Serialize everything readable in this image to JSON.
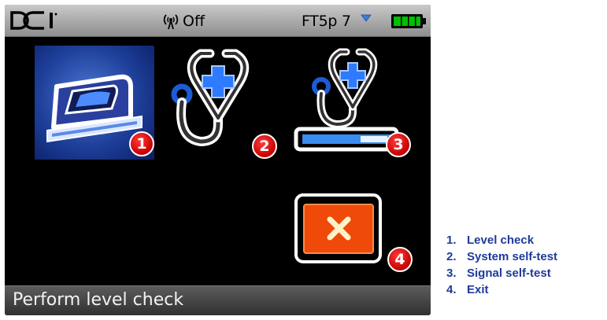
{
  "status_bar": {
    "logo_text": "DCI",
    "telemetry_label": "Off",
    "channel_label": "FT5p 7",
    "icons": [
      "dci-logo-icon",
      "telemetry-antenna-icon",
      "channel-dropdown-icon",
      "battery-icon"
    ],
    "battery_color": "#00c000"
  },
  "menu": {
    "items": [
      {
        "badge": "1",
        "icon": "level-check-icon",
        "selected": true
      },
      {
        "badge": "2",
        "icon": "system-self-test-stethoscope-icon",
        "selected": false
      },
      {
        "badge": "3",
        "icon": "signal-self-test-icon",
        "selected": false
      },
      {
        "badge": "4",
        "icon": "exit-icon",
        "selected": false
      }
    ]
  },
  "footer": {
    "message": "Perform level check"
  },
  "legend": {
    "items": [
      {
        "number": "1.",
        "label": "Level check"
      },
      {
        "number": "2.",
        "label": "System self-test"
      },
      {
        "number": "3.",
        "label": "Signal self-test"
      },
      {
        "number": "4.",
        "label": "Exit"
      }
    ]
  },
  "colors": {
    "selection_blue": "#1e3f9a",
    "badge_red": "#d40000",
    "exit_orange": "#f04a0a",
    "legend_blue": "#1f3a9a"
  }
}
